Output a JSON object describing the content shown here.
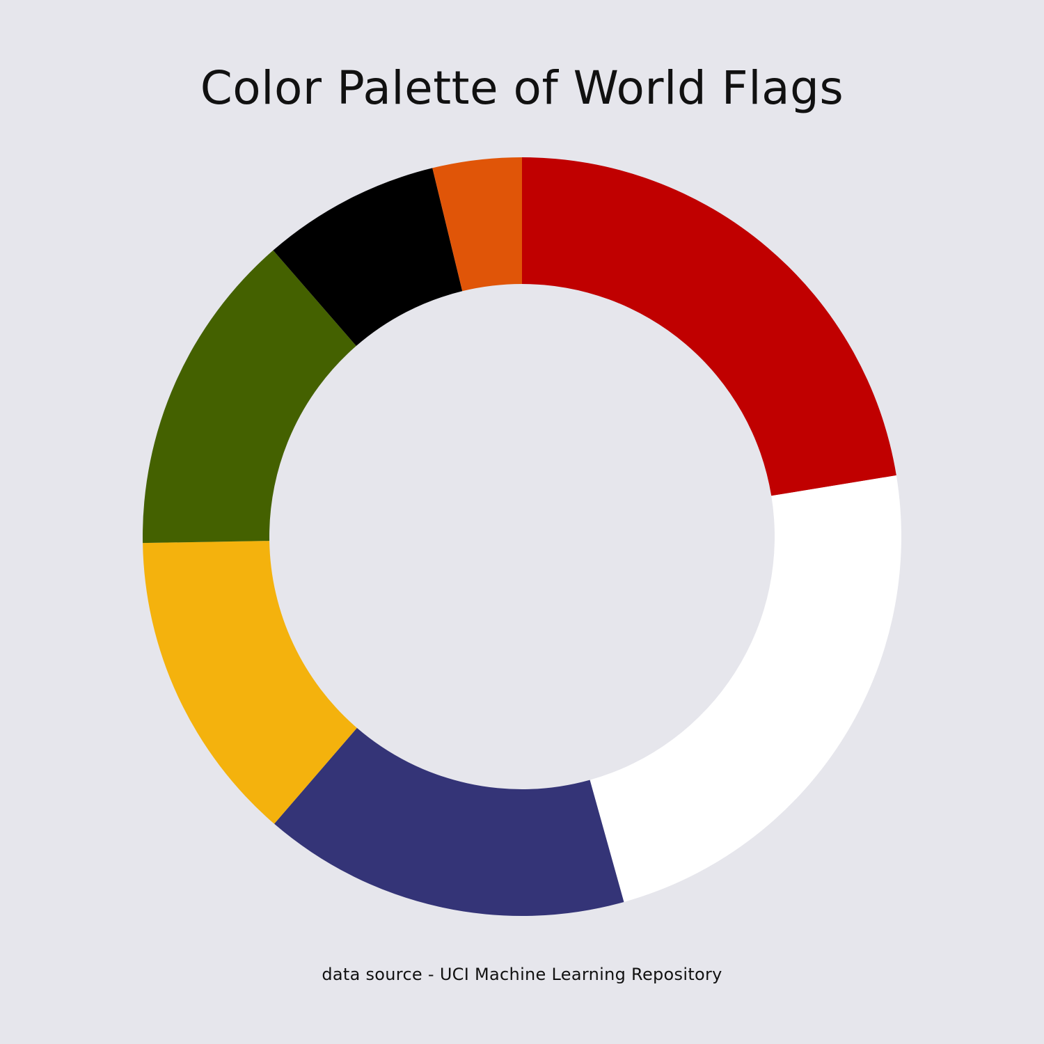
{
  "chart_data": {
    "type": "pie",
    "style": "donut",
    "title": "Color Palette of World Flags",
    "start_angle": "top",
    "direction": "clockwise",
    "legend": "none",
    "slices": [
      {
        "label": "red",
        "value": 189,
        "color": "#c00000"
      },
      {
        "label": "white",
        "value": 196,
        "color": "#ffffff"
      },
      {
        "label": "blue",
        "value": 132,
        "color": "#343477"
      },
      {
        "label": "gold",
        "value": 113,
        "color": "#f4b20d"
      },
      {
        "label": "green",
        "value": 117,
        "color": "#446100"
      },
      {
        "label": "black",
        "value": 64,
        "color": "#000000"
      },
      {
        "label": "orange",
        "value": 32,
        "color": "#e05508"
      }
    ]
  },
  "footer": {
    "source": "data source - UCI Machine Learning Repository"
  },
  "colors": {
    "background": "#e6e6ec",
    "text": "#111111"
  }
}
